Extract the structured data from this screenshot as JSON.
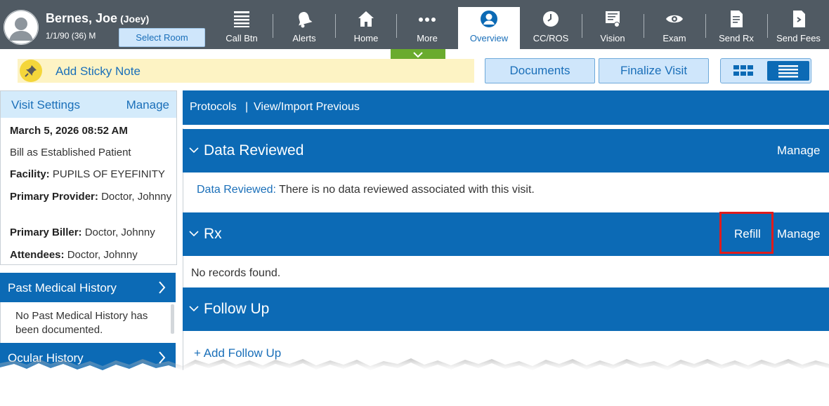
{
  "patient": {
    "name": "Bernes, Joe",
    "nickname": "(Joey)",
    "dob_age_sex": "1/1/90 (36) M",
    "select_room_label": "Select Room"
  },
  "nav": [
    {
      "label": "Call Btn",
      "icon": "list-icon"
    },
    {
      "label": "Alerts",
      "icon": "bell-icon"
    },
    {
      "label": "Home",
      "icon": "home-icon"
    },
    {
      "label": "More",
      "icon": "more-dots-icon"
    },
    {
      "label": "Overview",
      "icon": "person-circle-icon",
      "active": true
    },
    {
      "label": "CC/ROS",
      "icon": "clock-icon"
    },
    {
      "label": "Vision",
      "icon": "vision-chart-icon"
    },
    {
      "label": "Exam",
      "icon": "eye-icon"
    },
    {
      "label": "Send Rx",
      "icon": "send-rx-icon"
    },
    {
      "label": "Send Fees",
      "icon": "send-fees-icon"
    }
  ],
  "toolbar": {
    "sticky_label": "Add Sticky Note",
    "documents_label": "Documents",
    "finalize_label": "Finalize Visit"
  },
  "visit_settings": {
    "title": "Visit Settings",
    "manage_label": "Manage",
    "datetime": "March 5, 2026 08:52 AM",
    "bill_as": "Bill as Established Patient",
    "facility_label": "Facility:",
    "facility_value": "PUPILS OF EYEFINITY",
    "provider_label": "Primary Provider:",
    "provider_value": "Doctor, Johnny",
    "biller_label": "Primary Biller:",
    "biller_value": "Doctor, Johnny",
    "attendees_label": "Attendees:",
    "attendees_value": "Doctor, Johnny"
  },
  "past_medical_history": {
    "title": "Past Medical History",
    "empty_text": "No Past Medical History has been documented."
  },
  "ocular_history": {
    "title": "Ocular History"
  },
  "protocols": {
    "protocols_label": "Protocols",
    "separator": "|",
    "view_import_label": "View/Import Previous"
  },
  "data_reviewed": {
    "title": "Data Reviewed",
    "manage_label": "Manage",
    "label": "Data Reviewed:",
    "text": "There is no data reviewed associated with this visit."
  },
  "rx": {
    "title": "Rx",
    "refill_label": "Refill",
    "manage_label": "Manage",
    "empty_text": "No records found."
  },
  "follow_up": {
    "title": "Follow Up",
    "add_label": "+ Add Follow Up"
  },
  "colors": {
    "header_bg": "#505a63",
    "primary_blue": "#0c6ab5",
    "light_blue": "#cfe6fb",
    "sticky_bg": "#fdf3c4",
    "green_tab": "#6aab2e",
    "highlight_red": "#e01b1b"
  }
}
